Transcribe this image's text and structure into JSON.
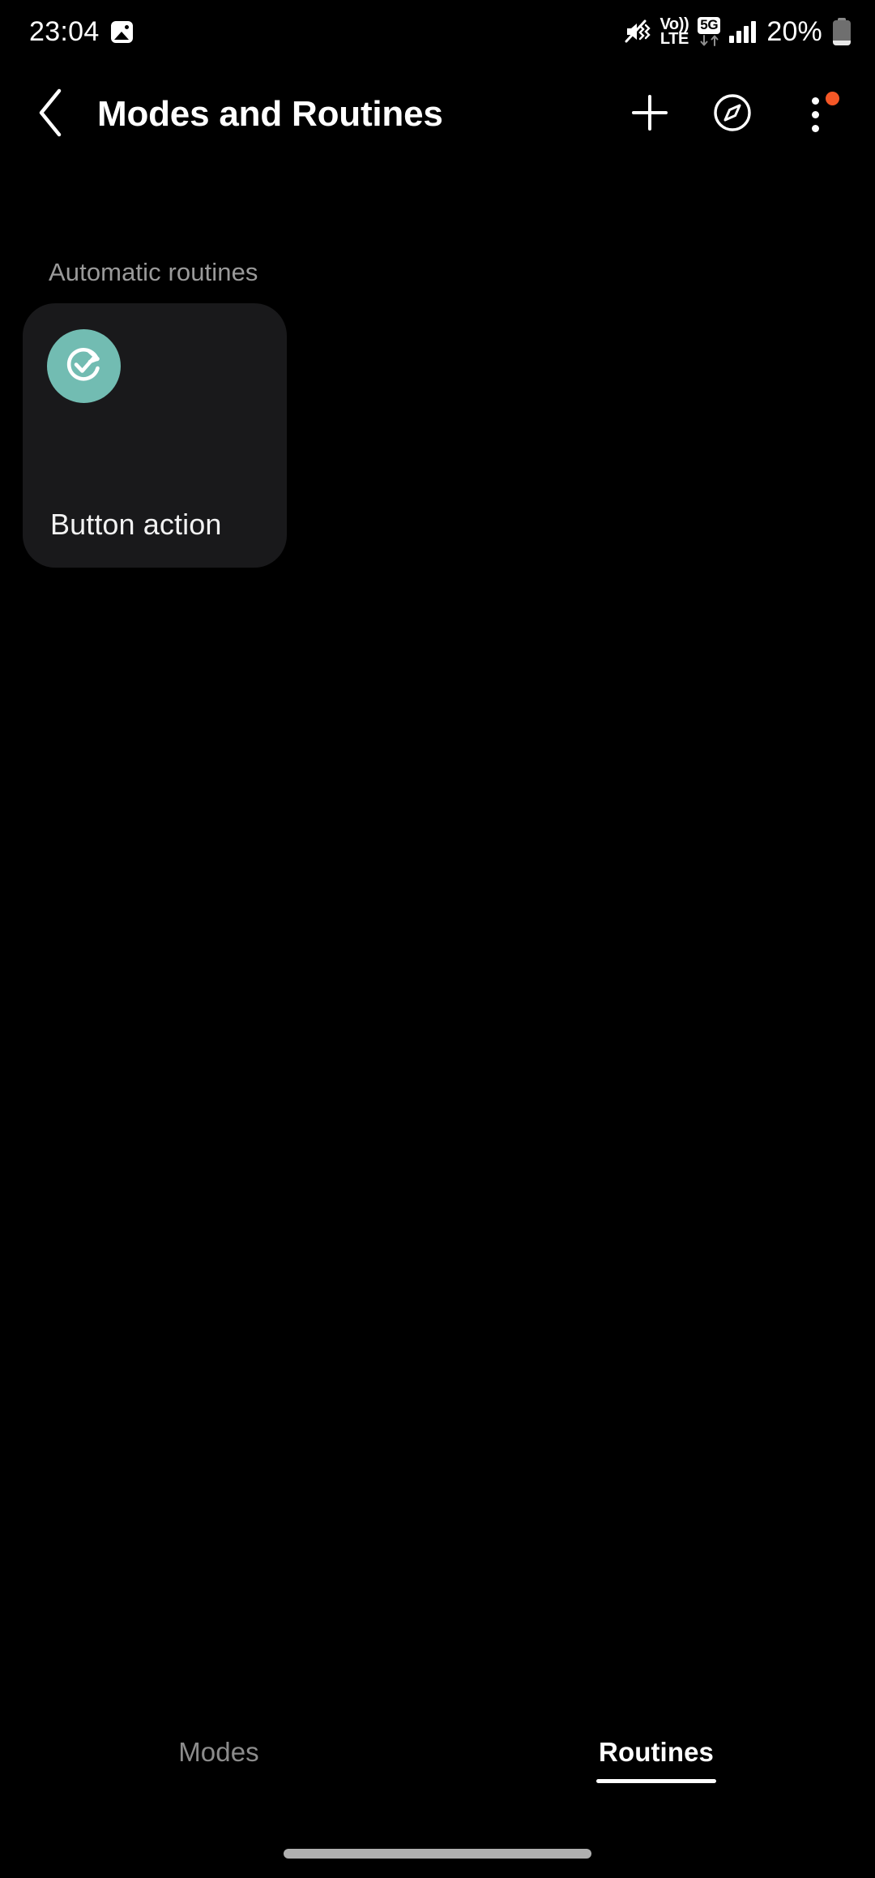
{
  "status_bar": {
    "time": "23:04",
    "battery_percent": "20%",
    "battery_level": 20,
    "icons": [
      "gallery-icon",
      "mute-vibrate-icon",
      "volte-icon",
      "5g-data-icon",
      "signal-bars-icon",
      "battery-icon"
    ],
    "volte_top": "Vo))",
    "volte_bottom": "LTE",
    "network_badge": "5G"
  },
  "app_bar": {
    "title": "Modes and Routines",
    "back_icon": "chevron-left-icon",
    "actions": [
      {
        "name": "add-routine-button",
        "icon": "plus-icon",
        "badge": false
      },
      {
        "name": "discover-button",
        "icon": "compass-icon",
        "badge": false
      },
      {
        "name": "more-options-button",
        "icon": "overflow-menu-icon",
        "badge": true
      }
    ],
    "badge_color": "#f55726"
  },
  "content": {
    "section_label": "Automatic routines",
    "routines": [
      {
        "name": "Button action",
        "icon": "routine-refresh-check-icon",
        "icon_bg": "#72bcb2",
        "card_bg": "#19191b"
      }
    ]
  },
  "bottom_tabs": {
    "items": [
      {
        "label": "Modes",
        "active": false
      },
      {
        "label": "Routines",
        "active": true
      }
    ]
  },
  "theme": {
    "background": "#000000",
    "text_primary": "#ffffff",
    "text_secondary": "#9a9a9a",
    "accent": "#72bcb2"
  }
}
